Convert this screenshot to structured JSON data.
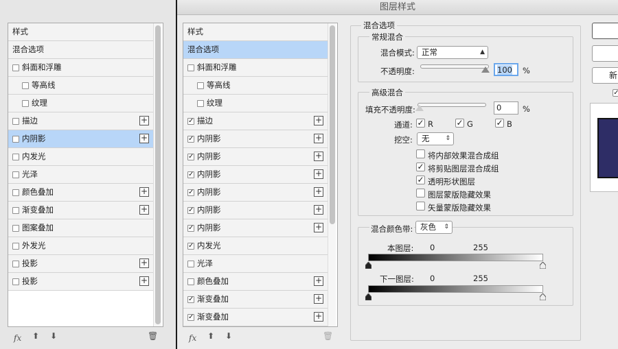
{
  "window_title": "图层样式",
  "left_panel": {
    "items": [
      {
        "label": "样式",
        "checkbox": false,
        "checked": false,
        "plus": false,
        "indent": 0,
        "selected": false
      },
      {
        "label": "混合选项",
        "checkbox": false,
        "checked": false,
        "plus": false,
        "indent": 0,
        "selected": false
      },
      {
        "label": "斜面和浮雕",
        "checkbox": true,
        "checked": false,
        "plus": false,
        "indent": 0,
        "selected": false
      },
      {
        "label": "等高线",
        "checkbox": true,
        "checked": false,
        "plus": false,
        "indent": 1,
        "selected": false
      },
      {
        "label": "纹理",
        "checkbox": true,
        "checked": false,
        "plus": false,
        "indent": 1,
        "selected": false
      },
      {
        "label": "描边",
        "checkbox": true,
        "checked": false,
        "plus": true,
        "indent": 0,
        "selected": false
      },
      {
        "label": "内阴影",
        "checkbox": true,
        "checked": false,
        "plus": true,
        "indent": 0,
        "selected": true
      },
      {
        "label": "内发光",
        "checkbox": true,
        "checked": false,
        "plus": false,
        "indent": 0,
        "selected": false
      },
      {
        "label": "光泽",
        "checkbox": true,
        "checked": false,
        "plus": false,
        "indent": 0,
        "selected": false
      },
      {
        "label": "颜色叠加",
        "checkbox": true,
        "checked": false,
        "plus": true,
        "indent": 0,
        "selected": false
      },
      {
        "label": "渐变叠加",
        "checkbox": true,
        "checked": false,
        "plus": true,
        "indent": 0,
        "selected": false
      },
      {
        "label": "图案叠加",
        "checkbox": true,
        "checked": false,
        "plus": false,
        "indent": 0,
        "selected": false
      },
      {
        "label": "外发光",
        "checkbox": true,
        "checked": false,
        "plus": false,
        "indent": 0,
        "selected": false
      },
      {
        "label": "投影",
        "checkbox": true,
        "checked": false,
        "plus": true,
        "indent": 0,
        "selected": false
      },
      {
        "label": "投影",
        "checkbox": true,
        "checked": false,
        "plus": true,
        "indent": 0,
        "selected": false
      }
    ],
    "fx_label": "fx"
  },
  "right_panel": {
    "items": [
      {
        "label": "样式",
        "checkbox": false,
        "checked": false,
        "plus": false,
        "indent": 0,
        "selected": false
      },
      {
        "label": "混合选项",
        "checkbox": false,
        "checked": false,
        "plus": false,
        "indent": 0,
        "selected": true
      },
      {
        "label": "斜面和浮雕",
        "checkbox": true,
        "checked": false,
        "plus": false,
        "indent": 0,
        "selected": false
      },
      {
        "label": "等高线",
        "checkbox": true,
        "checked": false,
        "plus": false,
        "indent": 1,
        "selected": false
      },
      {
        "label": "纹理",
        "checkbox": true,
        "checked": false,
        "plus": false,
        "indent": 1,
        "selected": false
      },
      {
        "label": "描边",
        "checkbox": true,
        "checked": true,
        "plus": true,
        "indent": 0,
        "selected": false
      },
      {
        "label": "内阴影",
        "checkbox": true,
        "checked": true,
        "plus": true,
        "indent": 0,
        "selected": false
      },
      {
        "label": "内阴影",
        "checkbox": true,
        "checked": true,
        "plus": true,
        "indent": 0,
        "selected": false
      },
      {
        "label": "内阴影",
        "checkbox": true,
        "checked": true,
        "plus": true,
        "indent": 0,
        "selected": false
      },
      {
        "label": "内阴影",
        "checkbox": true,
        "checked": true,
        "plus": true,
        "indent": 0,
        "selected": false
      },
      {
        "label": "内阴影",
        "checkbox": true,
        "checked": true,
        "plus": true,
        "indent": 0,
        "selected": false
      },
      {
        "label": "内阴影",
        "checkbox": true,
        "checked": true,
        "plus": true,
        "indent": 0,
        "selected": false
      },
      {
        "label": "内发光",
        "checkbox": true,
        "checked": true,
        "plus": false,
        "indent": 0,
        "selected": false
      },
      {
        "label": "光泽",
        "checkbox": true,
        "checked": false,
        "plus": false,
        "indent": 0,
        "selected": false
      },
      {
        "label": "颜色叠加",
        "checkbox": true,
        "checked": false,
        "plus": true,
        "indent": 0,
        "selected": false
      },
      {
        "label": "渐变叠加",
        "checkbox": true,
        "checked": true,
        "plus": true,
        "indent": 0,
        "selected": false
      },
      {
        "label": "渐变叠加",
        "checkbox": true,
        "checked": true,
        "plus": true,
        "indent": 0,
        "selected": false
      }
    ],
    "fx_label": "fx"
  },
  "blend": {
    "section_title": "混合选项",
    "general_title": "常规混合",
    "mode_label": "混合模式:",
    "mode_value": "正常",
    "opacity_label": "不透明度:",
    "opacity_value": "100",
    "percent": "%",
    "advanced_title": "高级混合",
    "fill_label": "填充不透明度:",
    "fill_value": "0",
    "channels_label": "通道:",
    "channel_r": "R",
    "channel_g": "G",
    "channel_b": "B",
    "knockout_label": "挖空:",
    "knockout_value": "无",
    "options": [
      {
        "label": "将内部效果混合成组",
        "checked": false
      },
      {
        "label": "将剪贴图层混合成组",
        "checked": true
      },
      {
        "label": "透明形状图层",
        "checked": true
      },
      {
        "label": "图层蒙版隐藏效果",
        "checked": false
      },
      {
        "label": "矢量蒙版隐藏效果",
        "checked": false
      }
    ],
    "blend_if_label": "混合颜色带:",
    "blend_if_value": "灰色",
    "this_layer_label": "本图层:",
    "this_layer_low": "0",
    "this_layer_high": "255",
    "underlying_label": "下一图层:",
    "underlying_low": "0",
    "underlying_high": "255"
  },
  "side_buttons": {
    "new_style_label": "新"
  },
  "colors": {
    "selection": "#b8d6f8",
    "preview": "#2e2d66"
  }
}
